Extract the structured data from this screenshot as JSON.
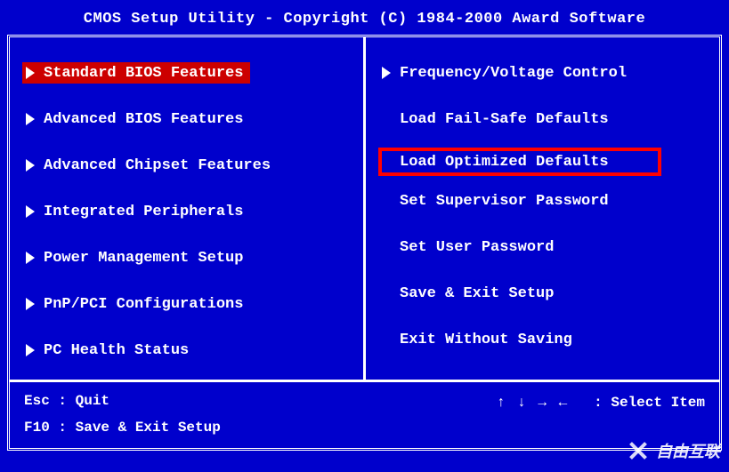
{
  "title": "CMOS Setup Utility - Copyright (C) 1984-2000 Award Software",
  "left_menu": [
    {
      "label": "Standard BIOS Features",
      "has_arrow": true,
      "selected": true
    },
    {
      "label": "Advanced BIOS Features",
      "has_arrow": true,
      "selected": false
    },
    {
      "label": "Advanced Chipset Features",
      "has_arrow": true,
      "selected": false
    },
    {
      "label": "Integrated Peripherals",
      "has_arrow": true,
      "selected": false
    },
    {
      "label": "Power Management Setup",
      "has_arrow": true,
      "selected": false
    },
    {
      "label": "PnP/PCI Configurations",
      "has_arrow": true,
      "selected": false
    },
    {
      "label": "PC Health Status",
      "has_arrow": true,
      "selected": false
    }
  ],
  "right_menu": [
    {
      "label": "Frequency/Voltage Control",
      "has_arrow": true,
      "highlighted": false
    },
    {
      "label": "Load Fail-Safe Defaults",
      "has_arrow": false,
      "highlighted": false
    },
    {
      "label": "Load Optimized Defaults",
      "has_arrow": false,
      "highlighted": true
    },
    {
      "label": "Set Supervisor Password",
      "has_arrow": false,
      "highlighted": false
    },
    {
      "label": "Set User Password",
      "has_arrow": false,
      "highlighted": false
    },
    {
      "label": "Save & Exit Setup",
      "has_arrow": false,
      "highlighted": false
    },
    {
      "label": "Exit Without Saving",
      "has_arrow": false,
      "highlighted": false
    }
  ],
  "footer": {
    "esc": "Esc : Quit",
    "f10": "F10 : Save & Exit Setup",
    "arrows": "↑ ↓ → ←",
    "select": ": Select Item"
  },
  "watermark": "自由互联"
}
